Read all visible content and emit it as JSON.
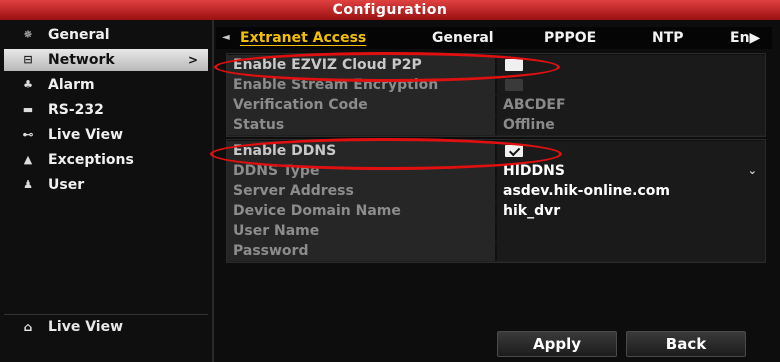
{
  "window": {
    "title": "Configuration"
  },
  "sidebar": {
    "items": [
      {
        "label": "General",
        "icon": "gear-icon",
        "glyph": "✵"
      },
      {
        "label": "Network",
        "icon": "network-icon",
        "glyph": "⊟",
        "chevron": ">"
      },
      {
        "label": "Alarm",
        "icon": "alarm-icon",
        "glyph": "♣"
      },
      {
        "label": "RS-232",
        "icon": "serial-port-icon",
        "glyph": "▬"
      },
      {
        "label": "Live View",
        "icon": "eye-icon",
        "glyph": "⊷"
      },
      {
        "label": "Exceptions",
        "icon": "warning-icon",
        "glyph": "▲"
      },
      {
        "label": "User",
        "icon": "users-icon",
        "glyph": "♟"
      }
    ],
    "bottom": {
      "label": "Live View",
      "icon": "home-icon",
      "glyph": "⌂"
    }
  },
  "tabs": {
    "scroll_arrow": "◄",
    "items": [
      "Extranet Access",
      "General",
      "PPPOE",
      "NTP",
      "En▶"
    ],
    "active": "Extranet Access"
  },
  "p2p": {
    "enable_label": "Enable EZVIZ Cloud P2P",
    "enable_checked": false,
    "stream_enc_label": "Enable Stream Encryption",
    "stream_enc_checked": false,
    "verification_label": "Verification Code",
    "verification_value": "ABCDEF",
    "status_label": "Status",
    "status_value": "Offline"
  },
  "ddns": {
    "enable_label": "Enable DDNS",
    "enable_checked": true,
    "type_label": "DDNS Type",
    "type_value": "HIDDNS",
    "dropdown_glyph": "⌄",
    "server_label": "Server Address",
    "server_value": "asdev.hik-online.com",
    "domain_label": "Device Domain Name",
    "domain_value": "hik_dvr",
    "username_label": "User Name",
    "username_value": "",
    "password_label": "Password",
    "password_value": ""
  },
  "buttons": {
    "apply": "Apply",
    "back": "Back"
  },
  "colors": {
    "title_bar": "#c42020",
    "active_tab": "#f2c000",
    "highlight_ellipse": "#e01010"
  }
}
